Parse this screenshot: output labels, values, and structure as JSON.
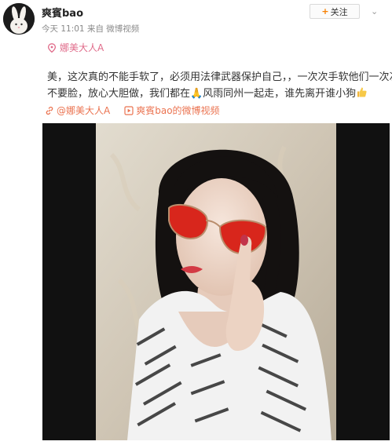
{
  "user": {
    "name": "爽賓bao",
    "time": "今天 11:01",
    "via_prefix": "来自",
    "source_app": "微博视频",
    "origin_tag": "娜美大人A"
  },
  "actions": {
    "follow": "关注",
    "follow_plus": "+"
  },
  "post": {
    "text_line1": "美，这次真的不能手软了，必须用法律武器保护自己，，一次次手软他们一次次",
    "text_line2": "不要脸，放心大胆做，我们都在🙏风雨同州一起走，谁先离开谁小狗"
  },
  "mentions": {
    "user_link": "@娜美大人A",
    "video_link": "爽賓bao的微博视频"
  },
  "colors": {
    "link": "#eb7350",
    "tag": "#e06b8a",
    "follow_plus": "#f77f00"
  }
}
